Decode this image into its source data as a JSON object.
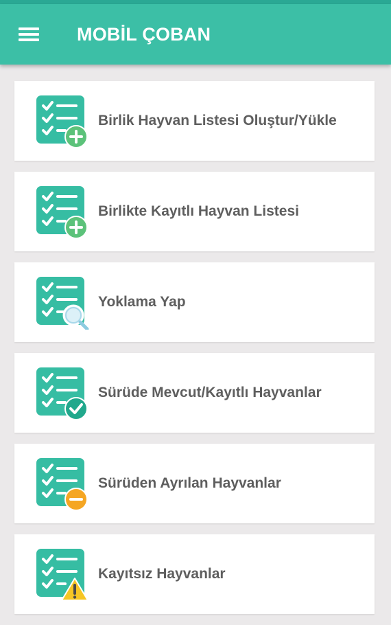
{
  "app": {
    "title": "MOBİL ÇOBAN"
  },
  "colors": {
    "accent": "#3cbfa6",
    "status_bar": "#2aa894",
    "icon_teal": "#36bda3",
    "badge_green": "#5cc27a",
    "badge_orange": "#f5a623",
    "badge_yellow": "#f6c624",
    "text": "#5e5e5e"
  },
  "header": {
    "menu_icon": "hamburger-menu-icon"
  },
  "menu": {
    "items": [
      {
        "label": "Birlik Hayvan Listesi Oluştur/Yükle",
        "icon": "checklist-add-icon"
      },
      {
        "label": "Birlikte Kayıtlı Hayvan Listesi",
        "icon": "checklist-add-icon"
      },
      {
        "label": "Yoklama Yap",
        "icon": "checklist-search-icon"
      },
      {
        "label": "Sürüde Mevcut/Kayıtlı Hayvanlar",
        "icon": "checklist-check-icon"
      },
      {
        "label": "Sürüden Ayrılan Hayvanlar",
        "icon": "checklist-remove-icon"
      },
      {
        "label": "Kayıtsız Hayvanlar",
        "icon": "checklist-warning-icon"
      }
    ]
  }
}
